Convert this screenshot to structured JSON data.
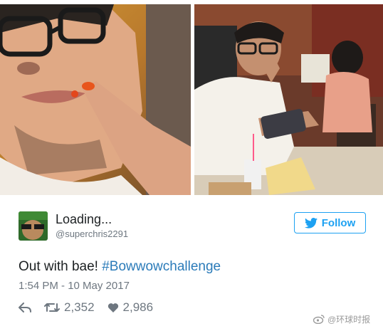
{
  "tweet": {
    "display_name": "Loading...",
    "handle": "@superchris2291",
    "text_prefix": "Out with bae! ",
    "hashtag": "#Bowwowchallenge",
    "timestamp": "1:54 PM - 10 May 2017",
    "follow_label": "Follow",
    "retweet_count": "2,352",
    "like_count": "2,986"
  },
  "icons": {
    "twitter": "twitter-bird-icon",
    "reply": "reply-icon",
    "retweet": "retweet-icon",
    "like": "heart-icon"
  },
  "colors": {
    "brand": "#1da1f2",
    "hashtag": "#2b7bb9",
    "text": "#1c2022",
    "muted": "#6e7780"
  },
  "watermark": {
    "text": "@环球时报"
  }
}
